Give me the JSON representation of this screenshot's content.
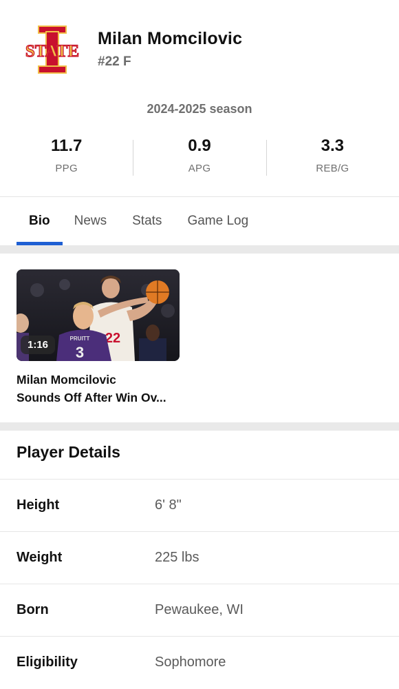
{
  "player": {
    "name": "Milan Momcilovic",
    "number_position": "#22 F",
    "team_logo": "iowa-state-logo",
    "logo_text": "STATE",
    "logo_colors": {
      "red": "#C8102E",
      "gold": "#F1BE48"
    }
  },
  "season": "2024-2025 season",
  "stats": [
    {
      "value": "11.7",
      "label": "PPG"
    },
    {
      "value": "0.9",
      "label": "APG"
    },
    {
      "value": "3.3",
      "label": "REB/G"
    }
  ],
  "tabs": [
    {
      "label": "Bio",
      "active": true
    },
    {
      "label": "News",
      "active": false
    },
    {
      "label": "Stats",
      "active": false
    },
    {
      "label": "Game Log",
      "active": false
    }
  ],
  "video": {
    "duration": "1:16",
    "title_line1": "Milan Momcilovic",
    "title_line2": "Sounds Off After Win Ov...",
    "jersey_front": "22",
    "jersey_back": "3",
    "back_name": "PRUITT"
  },
  "details": {
    "title": "Player Details",
    "rows": [
      {
        "label": "Height",
        "value": "6' 8\""
      },
      {
        "label": "Weight",
        "value": "225 lbs"
      },
      {
        "label": "Born",
        "value": "Pewaukee, WI"
      },
      {
        "label": "Eligibility",
        "value": "Sophomore"
      }
    ]
  },
  "accent_color": "#1E5FD3"
}
